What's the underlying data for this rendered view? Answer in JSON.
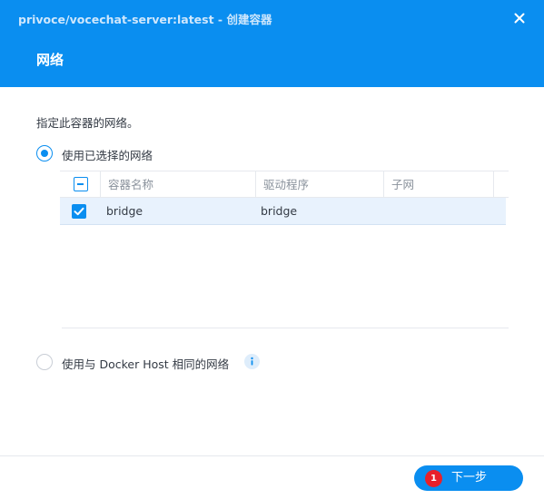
{
  "header": {
    "window_title": "privoce/vocechat-server:latest - 创建容器",
    "page_title": "网络",
    "close_icon": "close-icon"
  },
  "main": {
    "description": "指定此容器的网络。",
    "options": [
      {
        "label": "使用已选择的网络",
        "selected": true
      },
      {
        "label": "使用与 Docker Host 相同的网络",
        "selected": false,
        "icon": "info-icon"
      }
    ],
    "table": {
      "columns": [
        "容器名称",
        "驱动程序",
        "子网"
      ],
      "header_checkbox": "partial",
      "rows": [
        {
          "checked": true,
          "name": "bridge",
          "driver": "bridge",
          "subnet": ""
        }
      ]
    }
  },
  "footer": {
    "next_label": "下一步",
    "step_badge": "1"
  },
  "colors": {
    "accent": "#0a8ef0",
    "selected_row": "#e8f2fd",
    "badge": "#e8202a"
  }
}
